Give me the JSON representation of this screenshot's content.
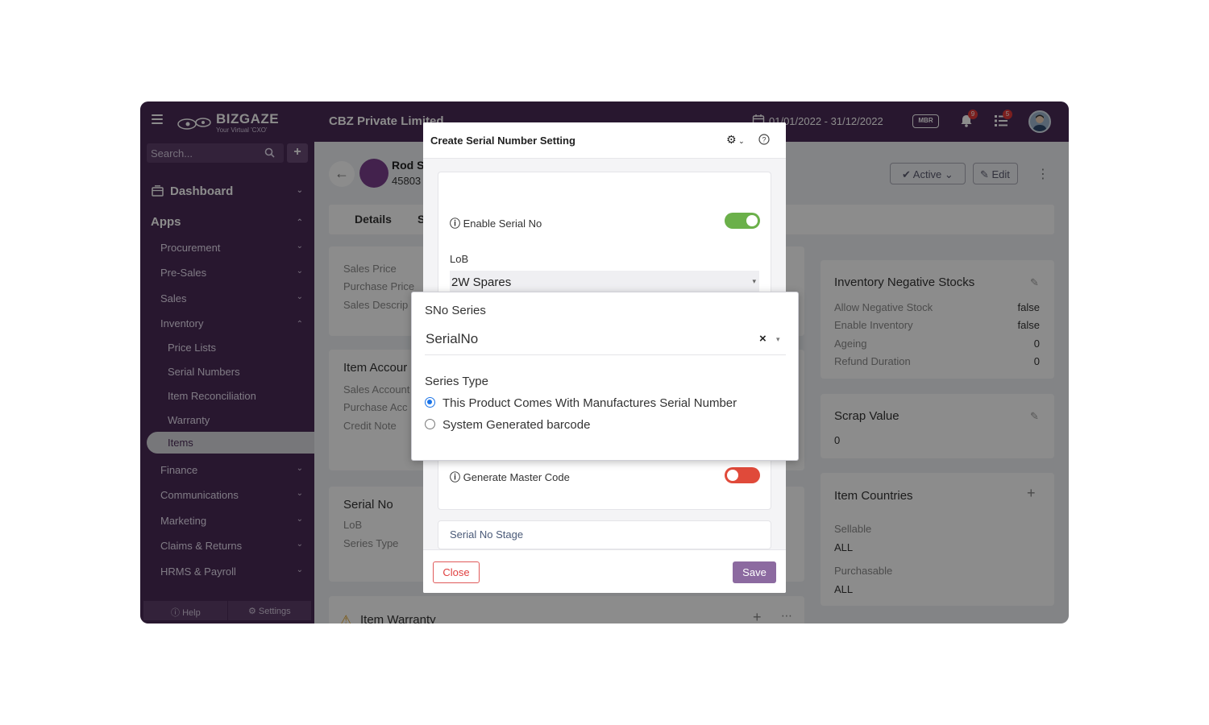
{
  "topbar": {
    "logo_text": "BIZGAZE",
    "logo_tagline": "Your Virtual 'CXO'",
    "company": "CBZ Private Limited",
    "date_range": "01/01/2022 - 31/12/2022",
    "mbr_label": "MBR",
    "notifications_count": "9",
    "tasks_count": "5"
  },
  "sidebar": {
    "search_placeholder": "Search...",
    "add_label": "+",
    "dashboard": "Dashboard",
    "apps": "Apps",
    "items": [
      "Procurement",
      "Pre-Sales",
      "Sales",
      "Inventory"
    ],
    "inventory_sub": [
      "Price Lists",
      "Serial Numbers",
      "Item Reconciliation",
      "Warranty",
      "Items"
    ],
    "items_after": [
      "Finance",
      "Communications",
      "Marketing",
      "Claims & Returns",
      "HRMS & Payroll"
    ],
    "help": "Help",
    "settings": "Settings"
  },
  "record": {
    "name": "Rod S",
    "code": "45803",
    "status": "Active",
    "edit": "Edit"
  },
  "tabs": {
    "details": "Details",
    "second": "S"
  },
  "left_cards": {
    "price": {
      "labels": [
        "Sales Price",
        "Purchase Price",
        "Sales Descrip"
      ]
    },
    "accounts": {
      "title": "Item Accour",
      "labels": [
        "Sales Account",
        "Purchase Acc",
        "Credit Note"
      ]
    },
    "serial": {
      "title": "Serial No",
      "labels": [
        "LoB",
        "Series Type"
      ]
    },
    "warranty": {
      "title": "Item Warranty"
    }
  },
  "right_cards": {
    "negative": {
      "title": "Inventory Negative Stocks",
      "rows": [
        {
          "label": "Allow Negative Stock",
          "value": "false"
        },
        {
          "label": "Enable Inventory",
          "value": "false"
        },
        {
          "label": "Ageing",
          "value": "0"
        },
        {
          "label": "Refund Duration",
          "value": "0"
        }
      ]
    },
    "scrap": {
      "title": "Scrap Value",
      "value": "0"
    },
    "countries": {
      "title": "Item Countries",
      "sellable_label": "Sellable",
      "sellable_value": "ALL",
      "purchasable_label": "Purchasable",
      "purchasable_value": "ALL"
    }
  },
  "modal": {
    "title": "Create Serial Number Setting",
    "enable_serial_label": "Enable Serial No",
    "enable_serial_on": true,
    "lob_label": "LoB",
    "lob_value": "2W Spares",
    "generate_master_label": "Generate Master Code",
    "generate_master_on": false,
    "stage_label": "Serial No Stage",
    "close": "Close",
    "save": "Save"
  },
  "popup": {
    "sno_series_label": "SNo Series",
    "sno_series_value": "SerialNo",
    "series_type_label": "Series Type",
    "options": [
      "This Product Comes With Manufactures Serial Number",
      "System Generated barcode"
    ],
    "selected_index": 0
  },
  "colors": {
    "brand": "#4a2a57",
    "toggle_on": "#6bb04a",
    "toggle_off": "#e04a3a",
    "save": "#8c6aa0",
    "radio": "#1a73e8"
  }
}
